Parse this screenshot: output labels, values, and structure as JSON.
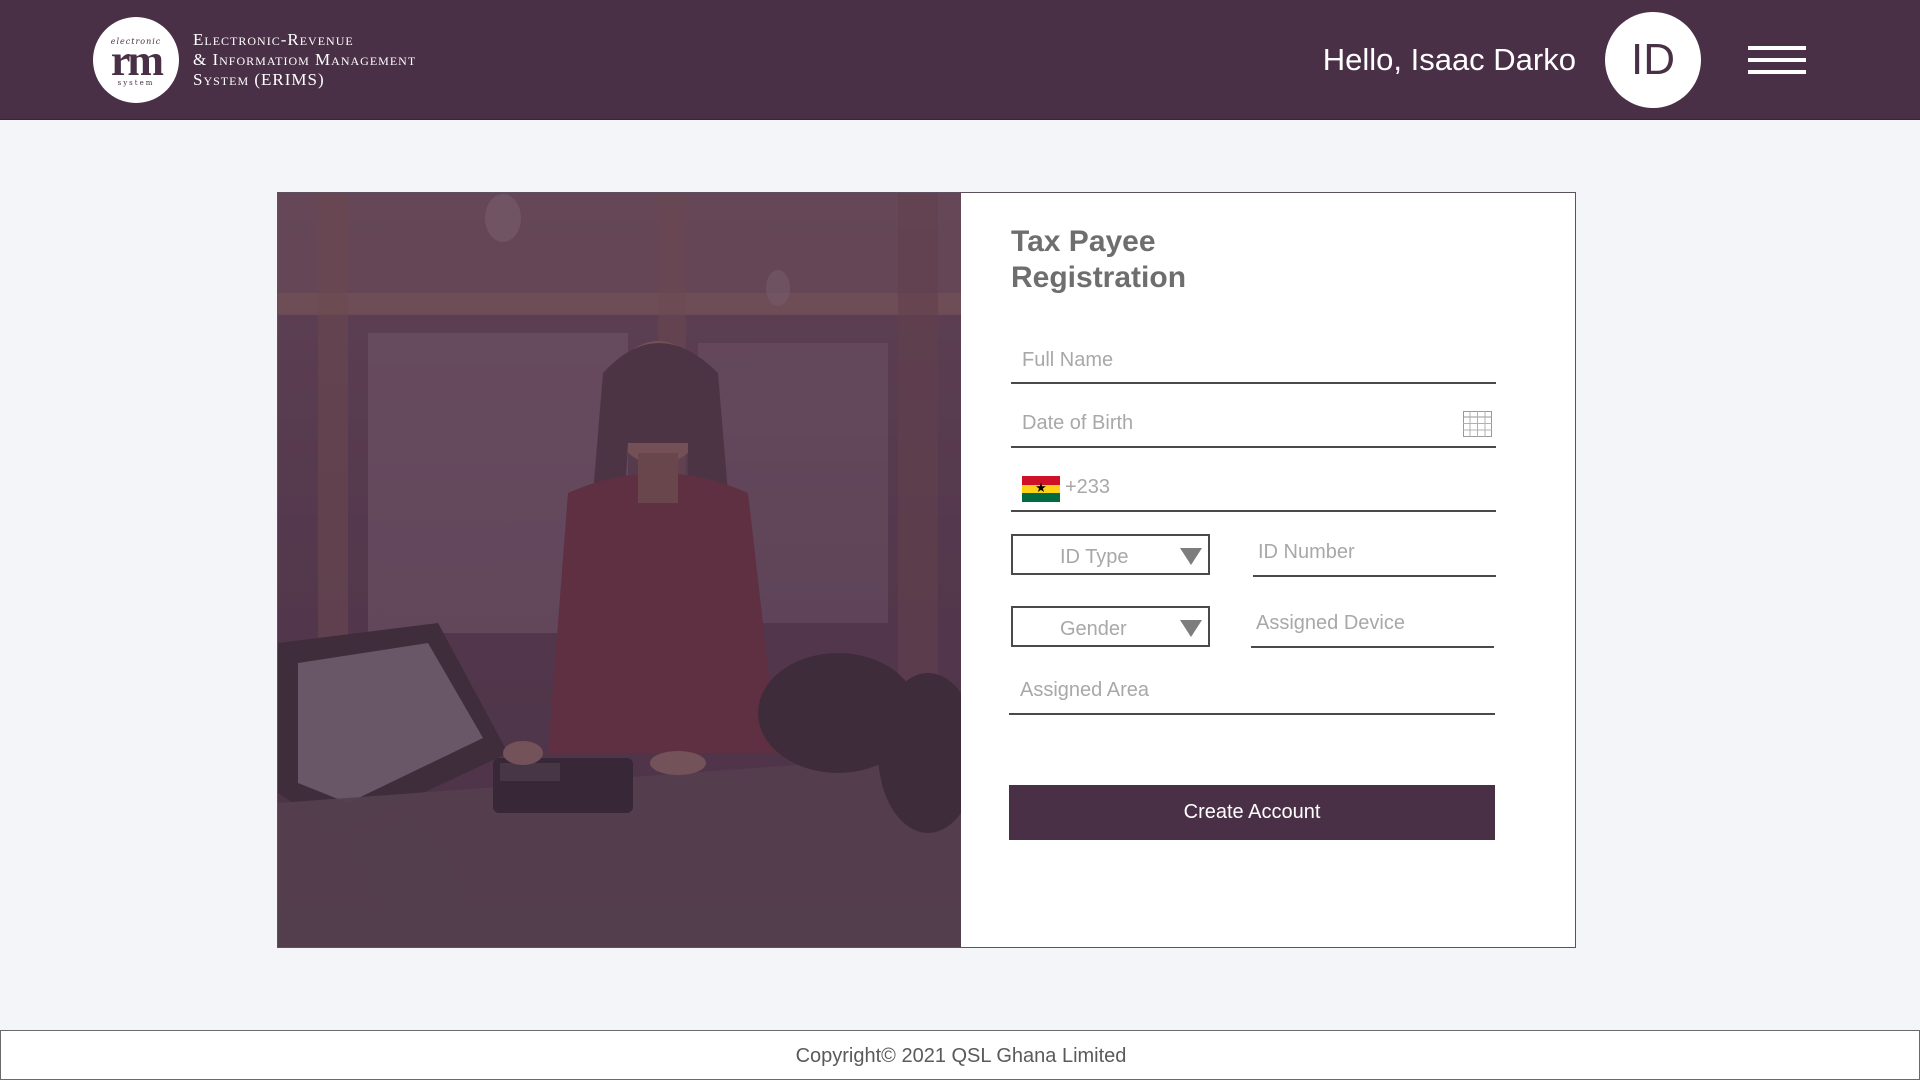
{
  "header": {
    "logo": {
      "top_text": "electronic",
      "main_text": "rm",
      "bottom_text": "system"
    },
    "brand_lines": [
      "Electronic-Revenue",
      "& Informatiom Management",
      "System (ERIMS)"
    ],
    "greeting": "Hello, Isaac Darko",
    "avatar_initials": "ID"
  },
  "form": {
    "title": "Tax Payee Registration",
    "full_name_placeholder": "Full Name",
    "dob_placeholder": "Date of Birth",
    "phone_placeholder": "+233",
    "id_type_label": "ID Type",
    "id_number_placeholder": "ID Number",
    "gender_label": "Gender",
    "assigned_device_placeholder": "Assigned Device",
    "assigned_area_placeholder": "Assigned Area",
    "submit_label": "Create Account"
  },
  "footer": {
    "copyright": "Copyright© 2021 QSL Ghana Limited"
  },
  "colors": {
    "brand": "#4a3046",
    "background": "#f4f5f8",
    "flag_red": "#ce1126",
    "flag_gold": "#fcd116",
    "flag_green": "#006b3f"
  }
}
